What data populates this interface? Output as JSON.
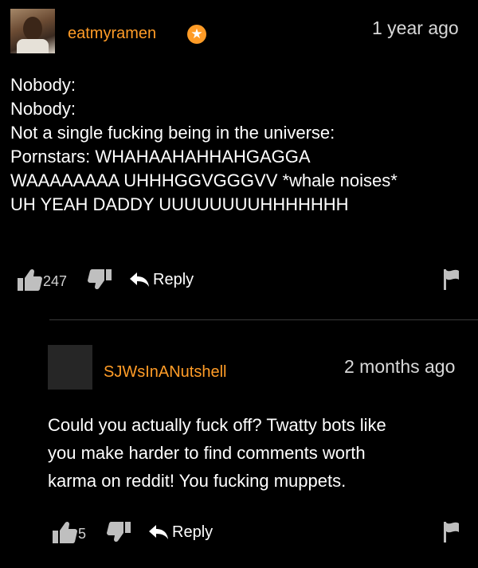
{
  "colors": {
    "accent": "#ff9c27",
    "background": "#000000"
  },
  "comments": [
    {
      "username": "eatmyramen",
      "badge_icon": "star-icon",
      "time": "1 year ago",
      "lines": [
        "Nobody:",
        "Nobody:",
        "Not a single fucking being in the universe:",
        "Pornstars: WHAHAAHAHHAHGAGGA",
        "WAAAAAAAA UHHHGGVGGGVV *whale noises*",
        "UH YEAH DADDY UUUUUUUUHHHHHHH"
      ],
      "upvotes": "247",
      "reply_label": "Reply"
    },
    {
      "username": "SJWsInANutshell",
      "time": "2 months ago",
      "lines": [
        "Could you actually fuck off? Twatty bots like",
        "you make harder to find comments worth",
        "karma on reddit! You fucking muppets."
      ],
      "upvotes": "5",
      "reply_label": "Reply"
    }
  ]
}
